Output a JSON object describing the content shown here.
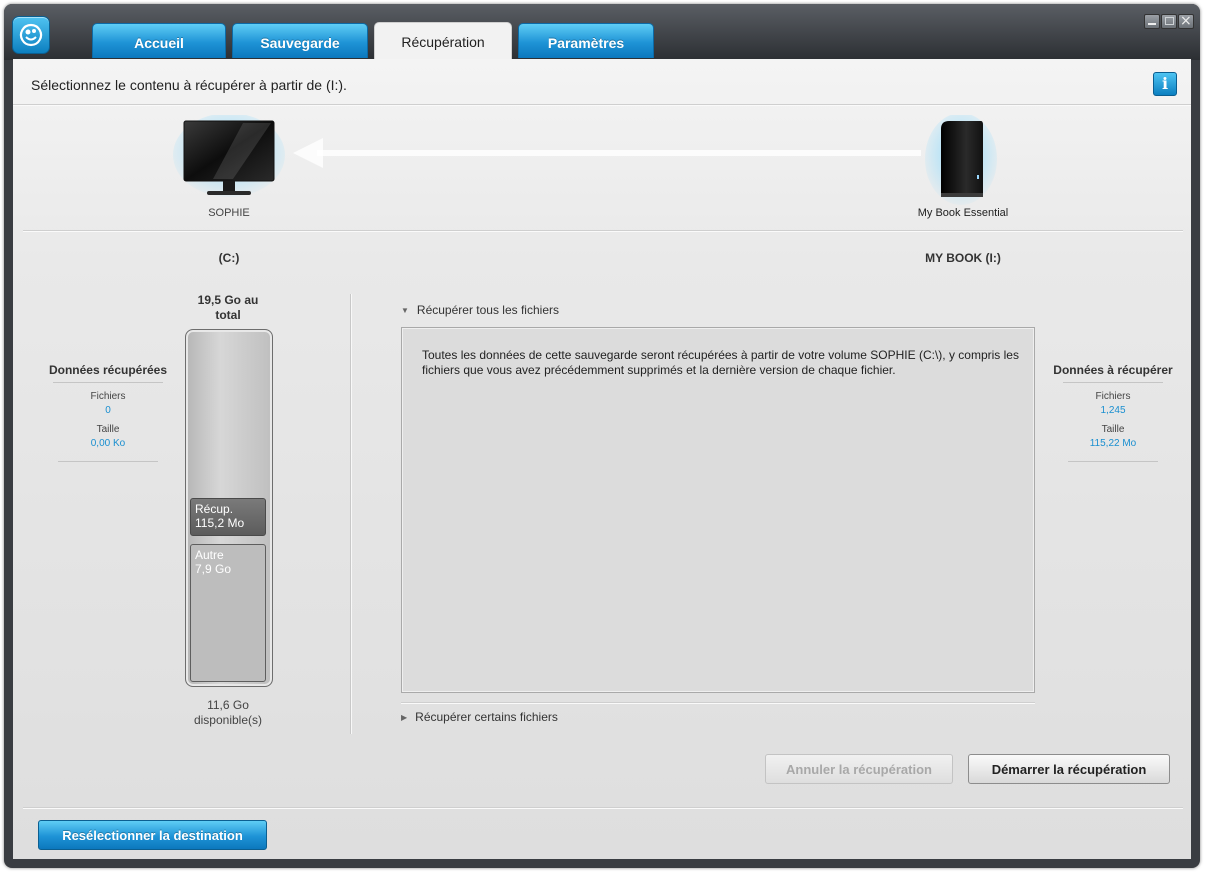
{
  "tabs": [
    {
      "label": "Accueil",
      "active": false
    },
    {
      "label": "Sauvegarde",
      "active": false
    },
    {
      "label": "Récupération",
      "active": true
    },
    {
      "label": "Paramètres",
      "active": false
    }
  ],
  "header": {
    "text": "Sélectionnez le contenu à récupérer à partir de  (I:).",
    "info_icon": "info-icon"
  },
  "source_device": {
    "name": "SOPHIE",
    "icon": "monitor-icon",
    "volume": "(C:)"
  },
  "dest_device": {
    "name": "My Book Essential",
    "icon": "external-drive-icon",
    "volume": "MY BOOK (I:)"
  },
  "left_stats": {
    "title": "Données récupérées",
    "files_label": "Fichiers",
    "files_value": "0",
    "size_label": "Taille",
    "size_value": "0,00 Ko"
  },
  "drive_gauge": {
    "total_line1": "19,5 Go au",
    "total_line2": "total",
    "recup_label": "Récup.",
    "recup_value": "115,2 Mo",
    "other_label": "Autre",
    "other_value": "7,9 Go",
    "free_line1": "11,6 Go",
    "free_line2": "disponible(s)"
  },
  "options": {
    "all_files": "Récupérer tous les fichiers",
    "all_files_desc": "Toutes les données de cette sauvegarde seront récupérées à partir de votre volume SOPHIE (C:\\), y compris les fichiers que vous avez précédemment supprimés et la dernière version de chaque fichier.",
    "some_files": "Récupérer certains fichiers"
  },
  "right_stats": {
    "title": "Données à récupérer",
    "files_label": "Fichiers",
    "files_value": "1,245",
    "size_label": "Taille",
    "size_value": "115,22 Mo"
  },
  "buttons": {
    "cancel": "Annuler la récupération",
    "start": "Démarrer la récupération",
    "reselect": "Resélectionner la destination"
  },
  "colors": {
    "accent": "#1e93d6",
    "value_blue": "#1a8fd0"
  }
}
